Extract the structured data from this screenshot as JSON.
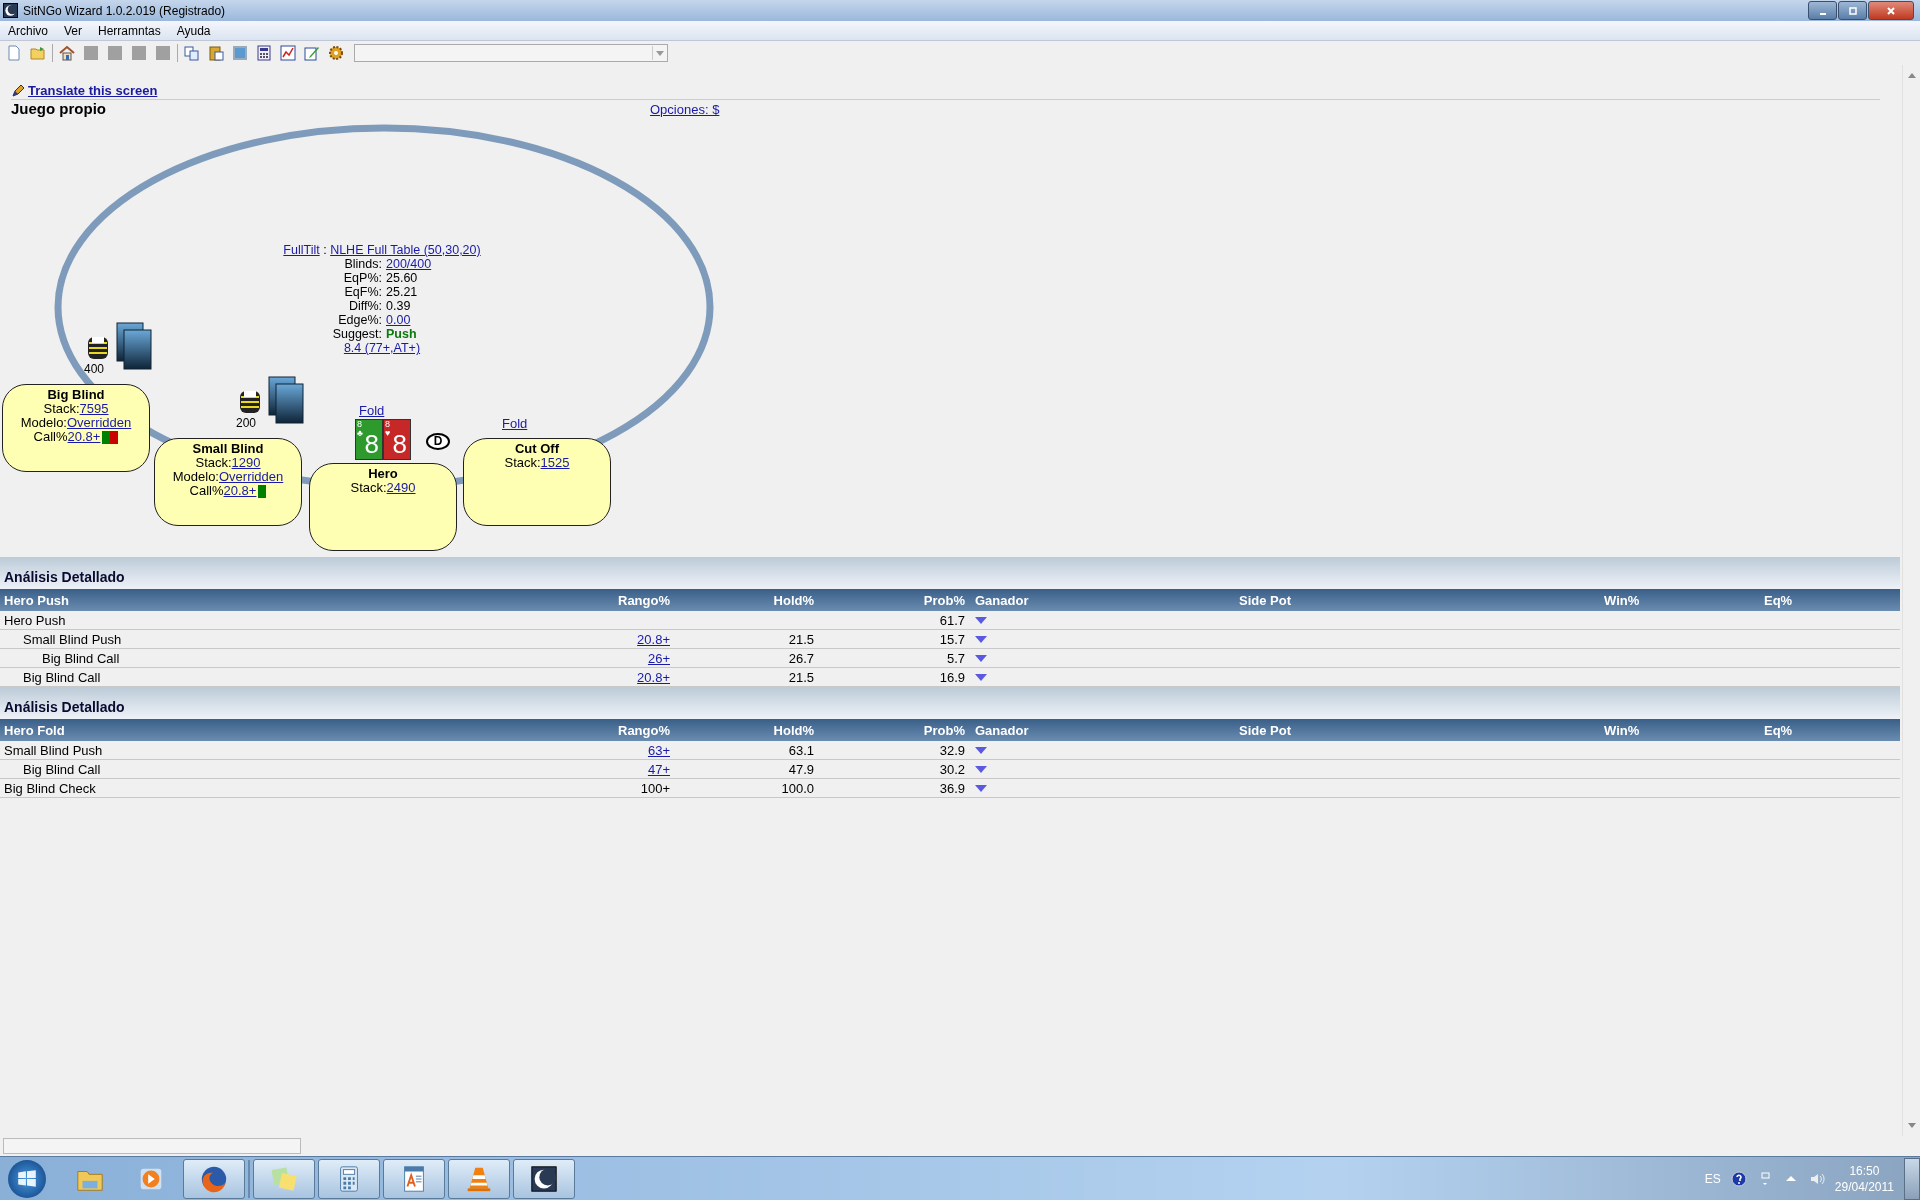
{
  "window": {
    "title": "SitNGo Wizard 1.0.2.019 (Registrado)"
  },
  "menu": [
    {
      "label": "Archivo"
    },
    {
      "label": "Ver"
    },
    {
      "label": "Herramntas"
    },
    {
      "label": "Ayuda"
    }
  ],
  "toolbar": {
    "buttons": [
      {
        "kind": "new"
      },
      {
        "kind": "open"
      },
      {
        "kind": "sep"
      },
      {
        "kind": "home"
      },
      {
        "kind": "blank",
        "disabled": true
      },
      {
        "kind": "blank",
        "disabled": true
      },
      {
        "kind": "blank",
        "disabled": true
      },
      {
        "kind": "blank",
        "disabled": true
      },
      {
        "kind": "sep"
      },
      {
        "kind": "copy"
      },
      {
        "kind": "paste"
      },
      {
        "kind": "image"
      },
      {
        "kind": "calc"
      },
      {
        "kind": "chart"
      },
      {
        "kind": "edit"
      },
      {
        "kind": "gear"
      }
    ]
  },
  "translate_link": "Translate this screen",
  "section_title": "Juego propio",
  "options_link": "Opciones: $",
  "table_info": {
    "site": "FullTilt",
    "separator": ":",
    "game": "NLHE Full Table (50,30,20)",
    "lines": [
      {
        "label": "Blinds:",
        "value": "200/400",
        "kind": "link"
      },
      {
        "label": "EqP%:",
        "value": "25.60",
        "kind": "plain"
      },
      {
        "label": "EqF%:",
        "value": "25.21",
        "kind": "plain"
      },
      {
        "label": "Diff%:",
        "value": "0.39",
        "kind": "plain"
      },
      {
        "label": "Edge%:",
        "value": "0.00",
        "kind": "link"
      },
      {
        "label": "Suggest:",
        "value": "Push",
        "kind": "strong"
      }
    ],
    "range_link": "8.4 (77+,AT+)"
  },
  "seats": [
    {
      "name": "Big Blind",
      "stack_label": "Stack:",
      "stack": "7595",
      "model_label": "Modelo:",
      "model": "Overridden",
      "call_label": "Call%",
      "call": "20.8+",
      "call_marks": [
        {
          "color": "#008000"
        },
        {
          "color": "#cc0000"
        }
      ],
      "bet": "400",
      "face_down_cards": true
    },
    {
      "name": "Small Blind",
      "stack_label": "Stack:",
      "stack": "1290",
      "model_label": "Modelo:",
      "model": "Overridden",
      "call_label": "Call%",
      "call": "20.8+",
      "call_marks": [
        {
          "color": "#008000"
        }
      ],
      "bet": "200",
      "face_down_cards": true
    },
    {
      "name": "Hero",
      "stack_label": "Stack:",
      "stack": "2490",
      "action": "Fold",
      "cards": [
        {
          "corner": "8",
          "suit": "♣",
          "rank": "8",
          "color": "#2e9a2e"
        },
        {
          "corner": "8",
          "suit": "♥",
          "rank": "8",
          "color": "#c62828"
        }
      ],
      "dealer": "D"
    },
    {
      "name": "Cut Off",
      "stack_label": "Stack:",
      "stack": "1525",
      "action": "Fold"
    }
  ],
  "analyses": [
    {
      "title": "Análisis Detallado",
      "columns": [
        "Hero Push",
        "Rango%",
        "Hold%",
        "Prob%",
        "Ganador",
        "Side Pot",
        "Win%",
        "Eq%"
      ],
      "rows": [
        {
          "label": "Hero Push",
          "prob": "61.7",
          "children": [
            {
              "label": "Small Blind Push",
              "rango": "20.8+",
              "rango_link": true,
              "hold": "21.5",
              "prob": "15.7",
              "children": [
                {
                  "label": "Big Blind Call",
                  "rango": "26+",
                  "rango_link": true,
                  "hold": "26.7",
                  "prob": "5.7"
                }
              ]
            },
            {
              "label": "Big Blind Call",
              "rango": "20.8+",
              "rango_link": true,
              "hold": "21.5",
              "prob": "16.9"
            }
          ]
        }
      ]
    },
    {
      "title": "Análisis Detallado",
      "columns": [
        "Hero Fold",
        "Rango%",
        "Hold%",
        "Prob%",
        "Ganador",
        "Side Pot",
        "Win%",
        "Eq%"
      ],
      "rows": [
        {
          "label": "Small Blind Push",
          "rango": "63+",
          "rango_link": true,
          "hold": "63.1",
          "prob": "32.9",
          "children": [
            {
              "label": "Big Blind Call",
              "rango": "47+",
              "rango_link": true,
              "hold": "47.9",
              "prob": "30.2"
            }
          ]
        },
        {
          "label": "Big Blind Check",
          "rango": "100+",
          "rango_link": false,
          "hold": "100.0",
          "prob": "36.9"
        }
      ]
    }
  ],
  "taskbar": {
    "apps": [
      {
        "kind": "explorer",
        "active": false
      },
      {
        "kind": "media",
        "active": false
      },
      {
        "kind": "firefox",
        "active": true
      },
      {
        "kind": "sep"
      },
      {
        "kind": "notes",
        "active": true
      },
      {
        "kind": "calc",
        "active": true
      },
      {
        "kind": "wordpad",
        "active": true
      },
      {
        "kind": "vlc",
        "active": true
      },
      {
        "kind": "app",
        "active": true
      }
    ],
    "language": "ES",
    "time": "16:50",
    "date": "29/04/2011"
  }
}
